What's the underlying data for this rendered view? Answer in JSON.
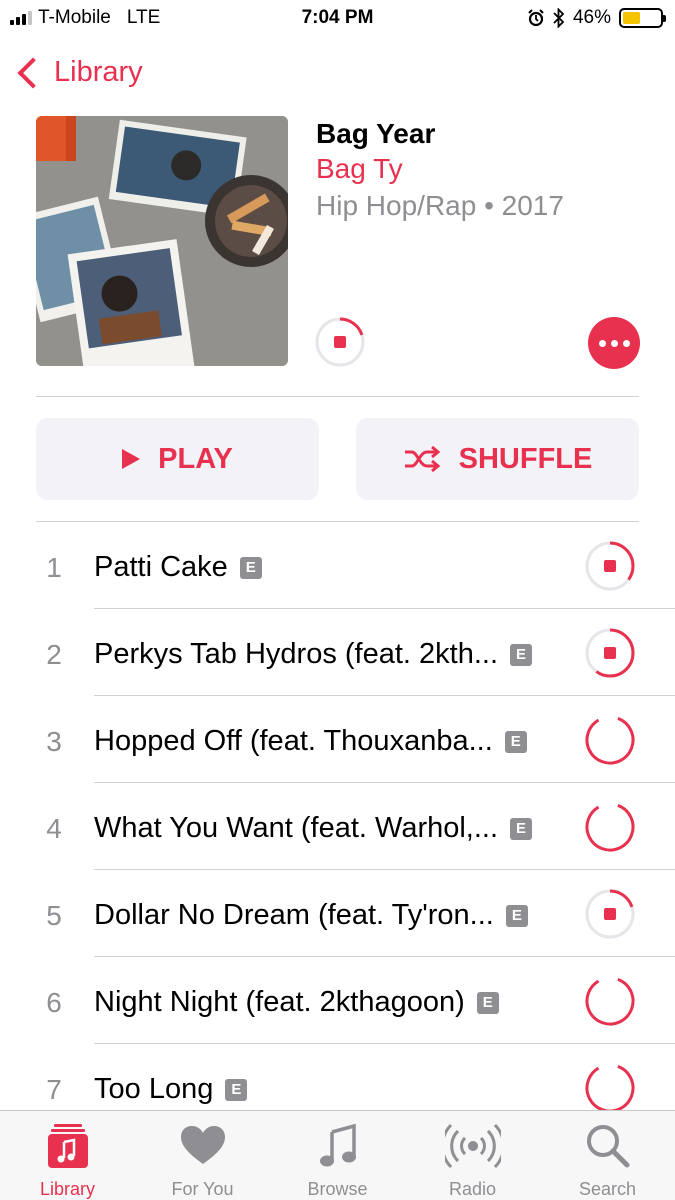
{
  "status_bar": {
    "carrier": "T-Mobile",
    "network": "LTE",
    "time": "7:04 PM",
    "battery_percent": "46%"
  },
  "nav": {
    "back_label": "Library"
  },
  "album": {
    "title": "Bag Year",
    "artist": "Bag Ty",
    "meta": "Hip Hop/Rap • 2017"
  },
  "actions": {
    "play_label": "PLAY",
    "shuffle_label": "SHUFFLE"
  },
  "tracks": [
    {
      "num": "1",
      "title": "Patti Cake",
      "explicit": "E",
      "download_state": "downloading",
      "progress": 0.35
    },
    {
      "num": "2",
      "title": "Perkys Tab Hydros (feat. 2kth...",
      "explicit": "E",
      "download_state": "downloading",
      "progress": 0.6
    },
    {
      "num": "3",
      "title": "Hopped Off (feat. Thouxanba...",
      "explicit": "E",
      "download_state": "waiting",
      "progress": 0
    },
    {
      "num": "4",
      "title": "What You Want (feat. Warhol,...",
      "explicit": "E",
      "download_state": "waiting",
      "progress": 0
    },
    {
      "num": "5",
      "title": "Dollar No Dream (feat. Ty'ron...",
      "explicit": "E",
      "download_state": "downloading",
      "progress": 0.2
    },
    {
      "num": "6",
      "title": "Night Night (feat. 2kthagoon)",
      "explicit": "E",
      "download_state": "waiting",
      "progress": 0
    },
    {
      "num": "7",
      "title": "Too Long",
      "explicit": "E",
      "download_state": "waiting",
      "progress": 0
    }
  ],
  "tabs": [
    {
      "label": "Library",
      "icon": "library-icon",
      "active": true
    },
    {
      "label": "For You",
      "icon": "heart-icon",
      "active": false
    },
    {
      "label": "Browse",
      "icon": "music-note-icon",
      "active": false
    },
    {
      "label": "Radio",
      "icon": "radio-icon",
      "active": false
    },
    {
      "label": "Search",
      "icon": "search-icon",
      "active": false
    }
  ],
  "colors": {
    "accent": "#e8304f",
    "secondary_text": "#8e8e93",
    "button_bg": "#f2f2f7"
  },
  "album_download_progress": 0.2
}
